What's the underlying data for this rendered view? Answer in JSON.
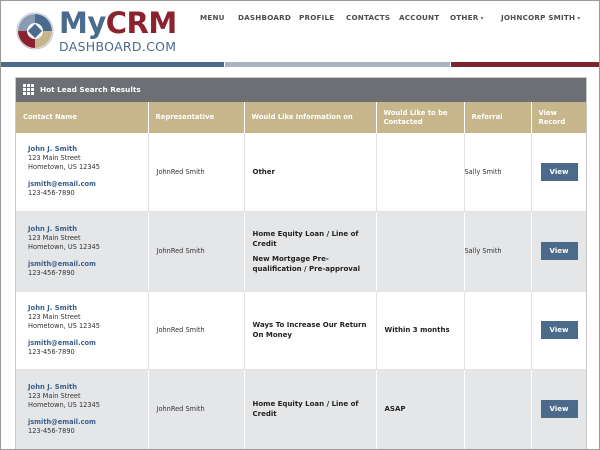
{
  "logo": {
    "my": "My",
    "crm": "CRM",
    "subtitle": "DASHBOARD.COM"
  },
  "nav": {
    "items": [
      {
        "label": "MENU"
      },
      {
        "label": "DASHBOARD"
      },
      {
        "label": "PROFILE"
      },
      {
        "label": "CONTACTS"
      },
      {
        "label": "ACCOUNT"
      },
      {
        "label": "OTHER",
        "caret": "▾"
      },
      {
        "label": "JOHNCORP SMITH",
        "caret": "▾"
      }
    ]
  },
  "panel": {
    "title": "Hot Lead Search Results"
  },
  "table": {
    "headers": [
      "Contact Name",
      "Representative",
      "Would Like Information on",
      "Would Like to be Contacted",
      "Referral",
      "View Record"
    ],
    "rows": [
      {
        "contact": {
          "name": "John J. Smith",
          "street": "123 Main Street",
          "city": "Hometown, US 12345",
          "email": "jsmith@email.com",
          "phone": "123-456-7890"
        },
        "representative": "JohnRed Smith",
        "info": [
          "Other"
        ],
        "contacted": "",
        "referral": "Sally Smith",
        "action": "View"
      },
      {
        "contact": {
          "name": "John J. Smith",
          "street": "123 Main Street",
          "city": "Hometown, US 12345",
          "email": "jsmith@email.com",
          "phone": "123-456-7890"
        },
        "representative": "JohnRed Smith",
        "info": [
          "Home Equity Loan / Line of Credit",
          "New Mortgage Pre-qualification / Pre-approval"
        ],
        "contacted": "",
        "referral": "Sally Smith",
        "action": "View"
      },
      {
        "contact": {
          "name": "John J. Smith",
          "street": "123 Main Street",
          "city": "Hometown, US 12345",
          "email": "jsmith@email.com",
          "phone": "123-456-7890"
        },
        "representative": "JohnRed Smith",
        "info": [
          "Ways To Increase Our Return On Money"
        ],
        "contacted": "Within 3 months",
        "referral": "",
        "action": "View"
      },
      {
        "contact": {
          "name": "John J. Smith",
          "street": "123 Main Street",
          "city": "Hometown, US 12345",
          "email": "jsmith@email.com",
          "phone": "123-456-7890"
        },
        "representative": "JohnRed Smith",
        "info": [
          "Home Equity Loan / Line of Credit"
        ],
        "contacted": "ASAP",
        "referral": "",
        "action": "View"
      }
    ]
  },
  "colors": {
    "brand_blue": "#4a6a8e",
    "brand_red": "#8b2230",
    "header_tan": "#c7b68b",
    "panel_head": "#6c7075",
    "button": "#4c6a8a"
  },
  "icons": {
    "logo_mark": "crm-logo-mark",
    "panel_icon": "grid-icon"
  }
}
